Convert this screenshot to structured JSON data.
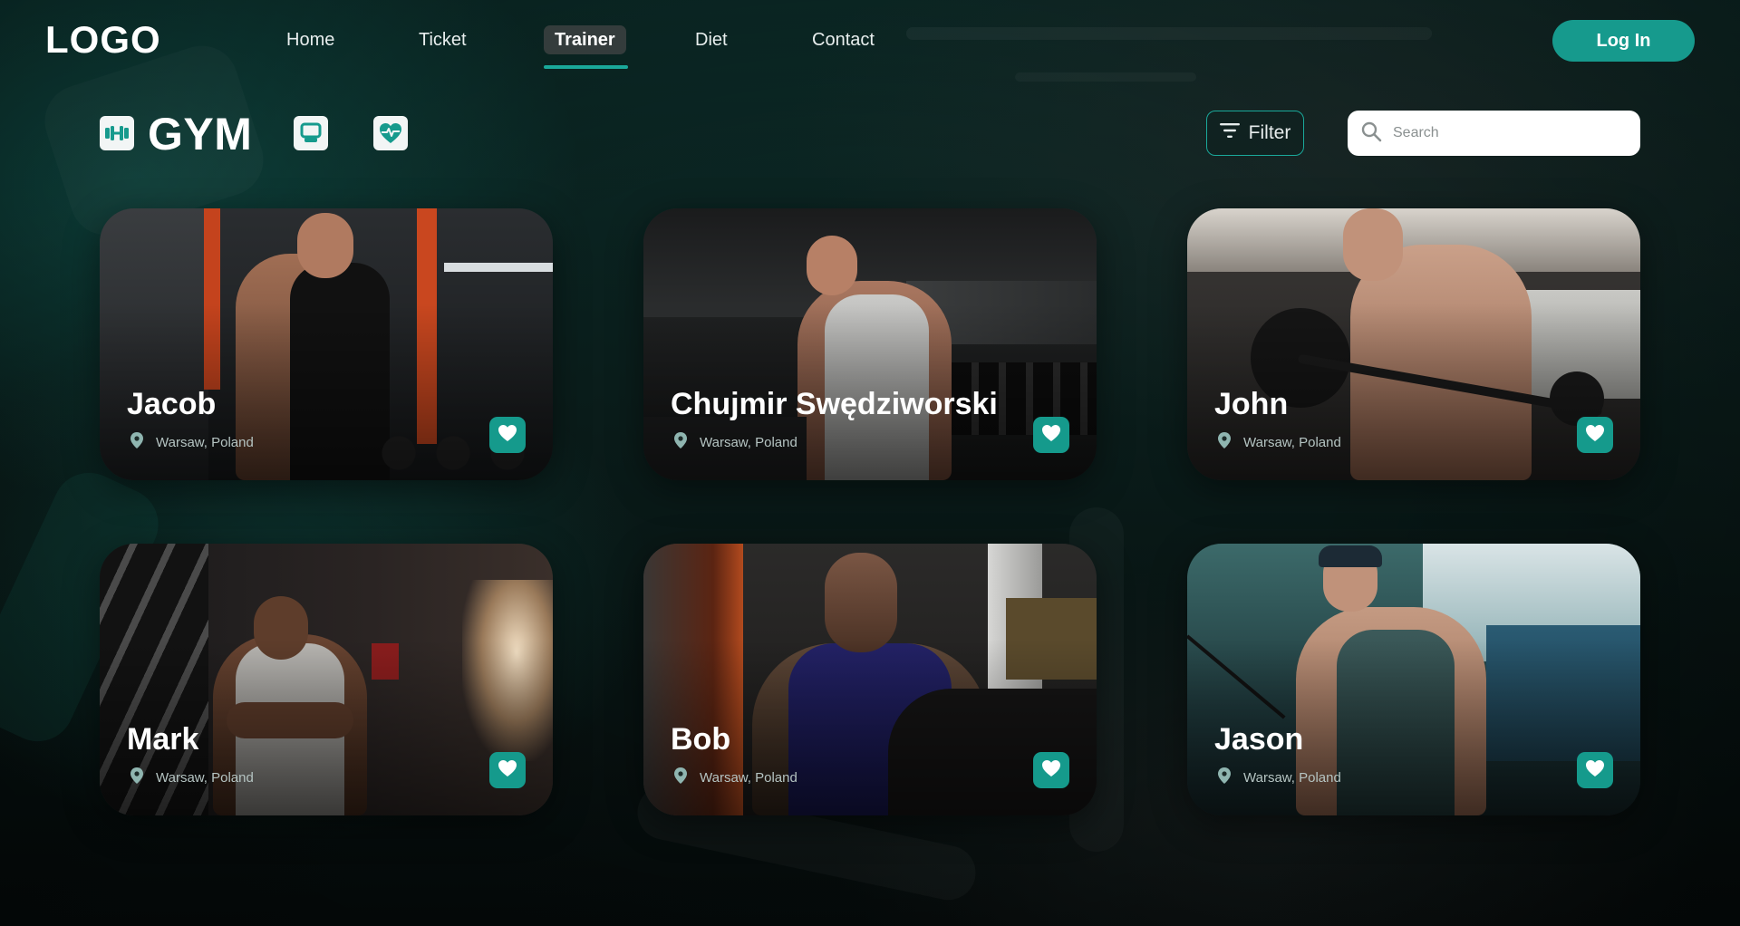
{
  "nav": {
    "logo": "LOGO",
    "items": [
      {
        "label": "Home"
      },
      {
        "label": "Ticket"
      },
      {
        "label": "Trainer",
        "active": true
      },
      {
        "label": "Diet"
      },
      {
        "label": "Contact"
      }
    ],
    "login_label": "Log In"
  },
  "toolbar": {
    "title": "GYM",
    "icons": [
      "dumbbell-icon",
      "monitor-icon",
      "heart-pulse-icon"
    ],
    "filter_label": "Filter",
    "search_placeholder": "Search"
  },
  "trainers": [
    {
      "name": "Jacob",
      "location": "Warsaw, Poland",
      "favorite": true
    },
    {
      "name": "Chujmir Swędziworski",
      "location": "Warsaw, Poland",
      "favorite": true
    },
    {
      "name": "John",
      "location": "Warsaw, Poland",
      "favorite": true
    },
    {
      "name": "Mark",
      "location": "Warsaw, Poland",
      "favorite": true
    },
    {
      "name": "Bob",
      "location": "Warsaw, Poland",
      "favorite": true
    },
    {
      "name": "Jason",
      "location": "Warsaw, Poland",
      "favorite": true
    }
  ],
  "colors": {
    "accent": "#169a8d",
    "accent_light": "#1aa89a",
    "background_dark": "#06110f",
    "background_teal": "#0b2a27"
  }
}
